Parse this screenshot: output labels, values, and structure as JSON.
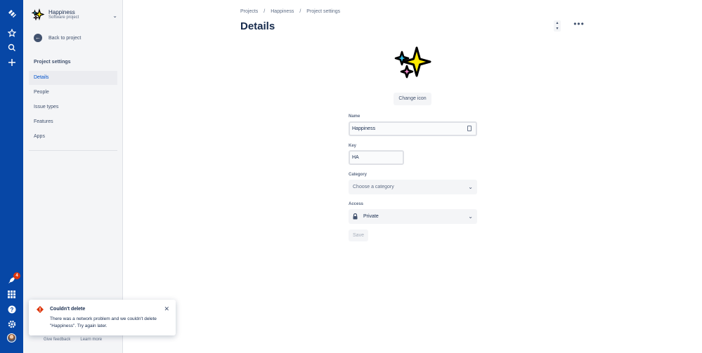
{
  "rail": {
    "notification_count": "4"
  },
  "sidebar": {
    "project_name": "Happiness",
    "project_type": "Software project",
    "back_label": "Back to project",
    "section_title": "Project settings",
    "items": [
      {
        "label": "Details",
        "active": true
      },
      {
        "label": "People",
        "active": false
      },
      {
        "label": "Issue types",
        "active": false
      },
      {
        "label": "Features",
        "active": false
      },
      {
        "label": "Apps",
        "active": false
      }
    ],
    "footer": {
      "feedback": "Give feedback",
      "learn": "Learn more"
    }
  },
  "flag": {
    "title": "Couldn't delete",
    "body": "There was a network problem and we couldn't delete \"Happiness\". Try again later."
  },
  "breadcrumb": [
    "Projects",
    "Happiness",
    "Project settings"
  ],
  "breadcrumb_sep": "/",
  "page_title": "Details",
  "form": {
    "change_icon_label": "Change icon",
    "name_label": "Name",
    "name_value": "Happiness",
    "key_label": "Key",
    "key_value": "HA",
    "category_label": "Category",
    "category_placeholder": "Choose a category",
    "access_label": "Access",
    "access_value": "Private",
    "save_label": "Save"
  },
  "colors": {
    "rail": "#0747a6",
    "active": "#0052cc",
    "error": "#de350b"
  },
  "icons": [
    "jira-logo-icon",
    "star-icon",
    "search-icon",
    "plus-icon",
    "rocket-icon",
    "apps-grid-icon",
    "help-icon",
    "gear-icon",
    "sparkle-icon",
    "lock-icon",
    "error-icon",
    "close-icon",
    "chevron-down-icon",
    "more-icon"
  ]
}
